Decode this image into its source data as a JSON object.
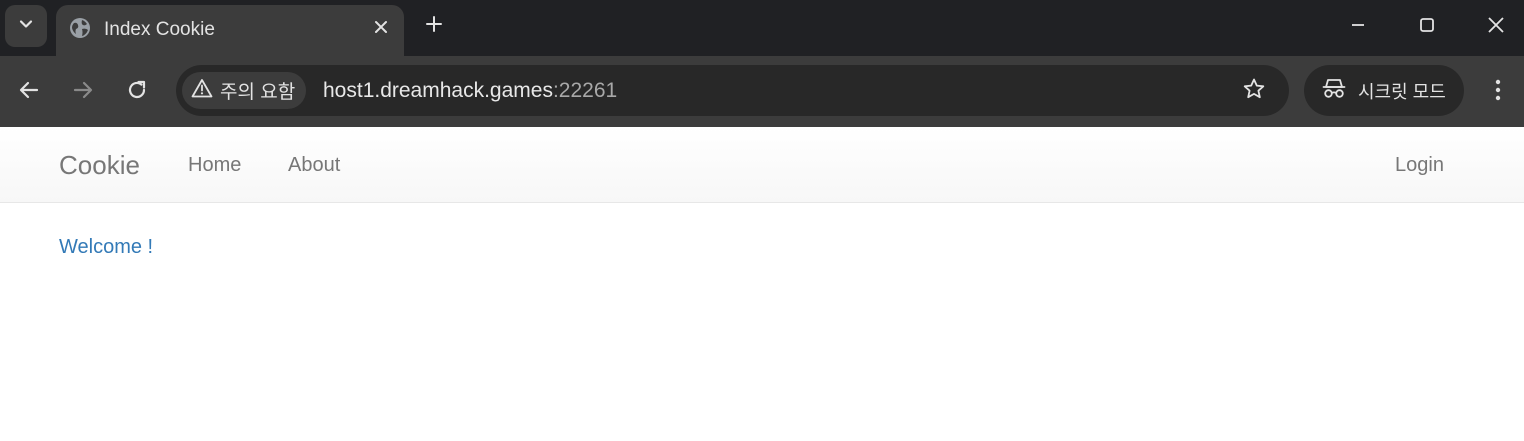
{
  "browser": {
    "tab": {
      "title": "Index Cookie",
      "favicon": "globe-icon"
    },
    "toolbar": {
      "security_chip": "주의 요함",
      "url_host": "host1.dreamhack.games",
      "url_port": ":22261",
      "incognito_label": "시크릿 모드"
    },
    "colors": {
      "tabstrip_bg": "#202124",
      "toolbar_bg": "#3c3c3c",
      "omnibox_bg": "#282828"
    }
  },
  "page": {
    "navbar": {
      "brand": "Cookie",
      "links": [
        "Home",
        "About"
      ],
      "login": "Login"
    },
    "welcome": "Welcome !",
    "colors": {
      "link_gray": "#777777",
      "welcome_blue": "#337ab7"
    }
  }
}
